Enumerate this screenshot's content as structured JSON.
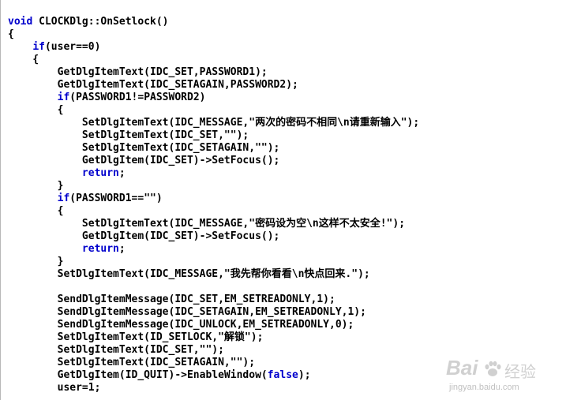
{
  "code_lines": [
    [
      {
        "t": "void",
        "c": "kw"
      },
      {
        "t": " CLOCKDlg::OnSetlock()"
      }
    ],
    [
      {
        "t": "{"
      }
    ],
    [
      {
        "t": "    "
      },
      {
        "t": "if",
        "c": "kw"
      },
      {
        "t": "(user==0)"
      }
    ],
    [
      {
        "t": "    {"
      }
    ],
    [
      {
        "t": "        GetDlgItemText(IDC_SET,PASSWORD1);"
      }
    ],
    [
      {
        "t": "        GetDlgItemText(IDC_SETAGAIN,PASSWORD2);"
      }
    ],
    [
      {
        "t": "        "
      },
      {
        "t": "if",
        "c": "kw"
      },
      {
        "t": "(PASSWORD1!=PASSWORD2)"
      }
    ],
    [
      {
        "t": "        {"
      }
    ],
    [
      {
        "t": "            SetDlgItemText(IDC_MESSAGE,\"两次的密码不相同\\n请重新输入\");"
      }
    ],
    [
      {
        "t": "            SetDlgItemText(IDC_SET,\"\");"
      }
    ],
    [
      {
        "t": "            SetDlgItemText(IDC_SETAGAIN,\"\");"
      }
    ],
    [
      {
        "t": "            GetDlgItem(IDC_SET)->SetFocus();"
      }
    ],
    [
      {
        "t": "            "
      },
      {
        "t": "return",
        "c": "kw"
      },
      {
        "t": ";"
      }
    ],
    [
      {
        "t": "        }"
      }
    ],
    [
      {
        "t": "        "
      },
      {
        "t": "if",
        "c": "kw"
      },
      {
        "t": "(PASSWORD1==\"\")"
      }
    ],
    [
      {
        "t": "        {"
      }
    ],
    [
      {
        "t": "            SetDlgItemText(IDC_MESSAGE,\"密码设为空\\n这样不太安全!\");"
      }
    ],
    [
      {
        "t": "            GetDlgItem(IDC_SET)->SetFocus();"
      }
    ],
    [
      {
        "t": "            "
      },
      {
        "t": "return",
        "c": "kw"
      },
      {
        "t": ";"
      }
    ],
    [
      {
        "t": "        }"
      }
    ],
    [
      {
        "t": "        SetDlgItemText(IDC_MESSAGE,\"我先帮你看看\\n快点回来.\");"
      }
    ],
    [
      {
        "t": ""
      }
    ],
    [
      {
        "t": "        SendDlgItemMessage(IDC_SET,EM_SETREADONLY,1);"
      }
    ],
    [
      {
        "t": "        SendDlgItemMessage(IDC_SETAGAIN,EM_SETREADONLY,1);"
      }
    ],
    [
      {
        "t": "        SendDlgItemMessage(IDC_UNLOCK,EM_SETREADONLY,0);"
      }
    ],
    [
      {
        "t": "        SetDlgItemText(ID_SETLOCK,\"解锁\");"
      }
    ],
    [
      {
        "t": "        SetDlgItemText(IDC_SET,\"\");"
      }
    ],
    [
      {
        "t": "        SetDlgItemText(IDC_SETAGAIN,\"\");"
      }
    ],
    [
      {
        "t": "        GetDlgItem(ID_QUIT)->EnableWindow("
      },
      {
        "t": "false",
        "c": "kw"
      },
      {
        "t": ");"
      }
    ],
    [
      {
        "t": "        user=1;"
      }
    ]
  ],
  "colors": {
    "keyword": "#0000cc",
    "text": "#000000",
    "background": "#ffffff"
  },
  "watermark": {
    "logo": "Bai",
    "logo_icon": "paw-icon",
    "brand": "经验",
    "url": "jingyan.baidu.com"
  }
}
